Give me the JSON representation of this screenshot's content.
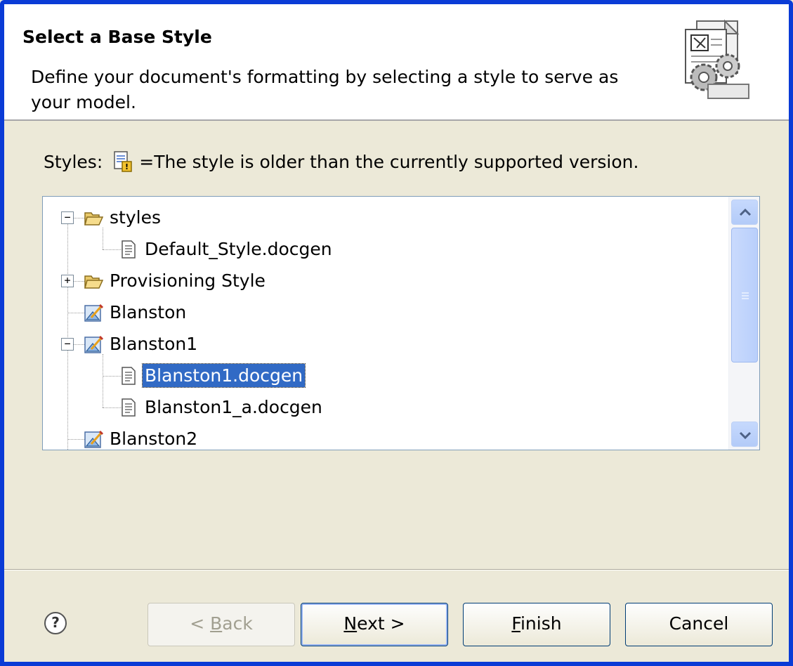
{
  "header": {
    "title": "Select a Base Style",
    "description": "Define your document's formatting by selecting a style to serve as your model.",
    "image_icon": "document-gears-icon"
  },
  "legend": {
    "prefix": "Styles:",
    "icon": "outdated-style-icon",
    "text": "=The style is older than the currently supported version."
  },
  "tree": {
    "items": [
      {
        "label": "styles",
        "icon": "folder-open-icon",
        "expander": "−",
        "selected": false
      },
      {
        "label": "Default_Style.docgen",
        "icon": "document-icon",
        "expander": "",
        "selected": false
      },
      {
        "label": "Provisioning Style",
        "icon": "folder-open-icon",
        "expander": "+",
        "selected": false
      },
      {
        "label": "Blanston",
        "icon": "style-project-icon",
        "expander": "",
        "selected": false
      },
      {
        "label": "Blanston1",
        "icon": "style-project-icon",
        "expander": "−",
        "selected": false
      },
      {
        "label": "Blanston1.docgen",
        "icon": "document-icon",
        "expander": "",
        "selected": true
      },
      {
        "label": "Blanston1_a.docgen",
        "icon": "document-icon",
        "expander": "",
        "selected": false
      },
      {
        "label": "Blanston2",
        "icon": "style-project-icon",
        "expander": "",
        "selected": false
      }
    ]
  },
  "buttons": {
    "back": {
      "prefix": "< ",
      "mnemonic": "B",
      "rest": "ack",
      "enabled": false
    },
    "next": {
      "mnemonic": "N",
      "rest": "ext >",
      "enabled": true
    },
    "finish": {
      "mnemonic": "F",
      "rest": "inish",
      "enabled": true
    },
    "cancel": {
      "label": "Cancel",
      "enabled": true
    }
  },
  "help": {
    "icon": "help-icon",
    "symbol": "?"
  },
  "colors": {
    "window_border": "#0a3bd6",
    "dialog_bg": "#ece9d8",
    "selection": "#316ac5"
  }
}
